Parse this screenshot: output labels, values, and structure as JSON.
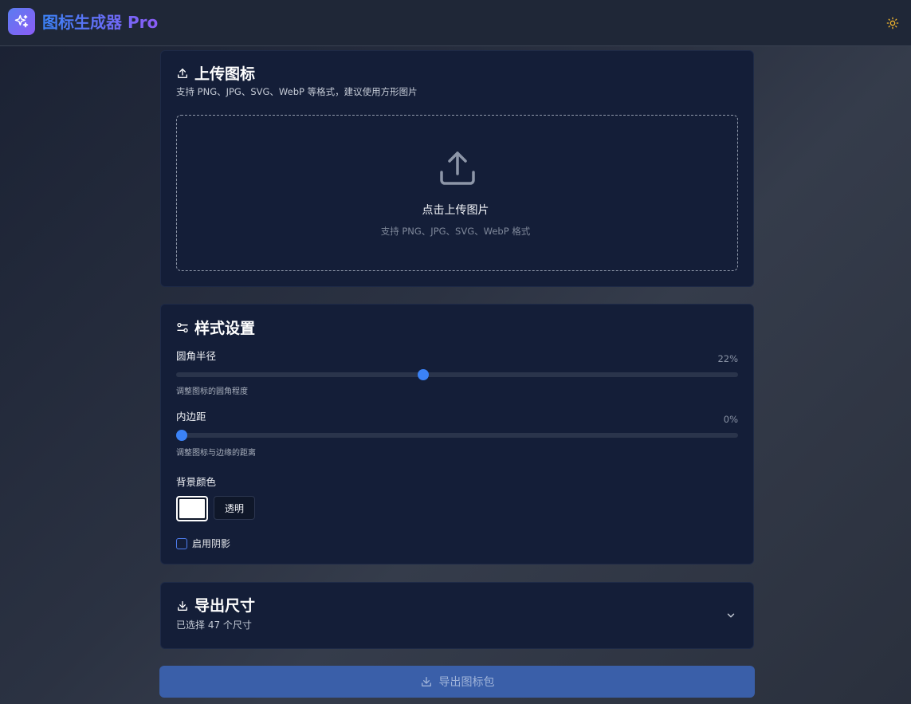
{
  "header": {
    "title": "图标生成器 Pro",
    "logo_icon": "sparkles-icon",
    "theme_icon": "sun-icon",
    "accent_from": "#3b82f6",
    "accent_to": "#8b5cf6"
  },
  "upload": {
    "title": "上传图标",
    "subtitle": "支持 PNG、JPG、SVG、WebP 等格式，建议使用方形图片",
    "drop_title": "点击上传图片",
    "drop_sub": "支持 PNG、JPG、SVG、WebP 格式"
  },
  "style": {
    "title": "样式设置",
    "radius": {
      "label": "圆角半径",
      "value": "22%",
      "level": 0.44,
      "hint": "调整图标的圆角程度"
    },
    "padding": {
      "label": "内边距",
      "value": "0%",
      "level": 0.0,
      "hint": "调整图标与边缘的距离"
    },
    "bg": {
      "label": "背景颜色",
      "color": "#ffffff",
      "transparent_label": "透明"
    },
    "shadow": {
      "label": "启用阴影",
      "checked": false
    }
  },
  "export_sizes": {
    "title": "导出尺寸",
    "subtitle": "已选择 47 个尺寸"
  },
  "export_button": {
    "label": "导出图标包"
  }
}
